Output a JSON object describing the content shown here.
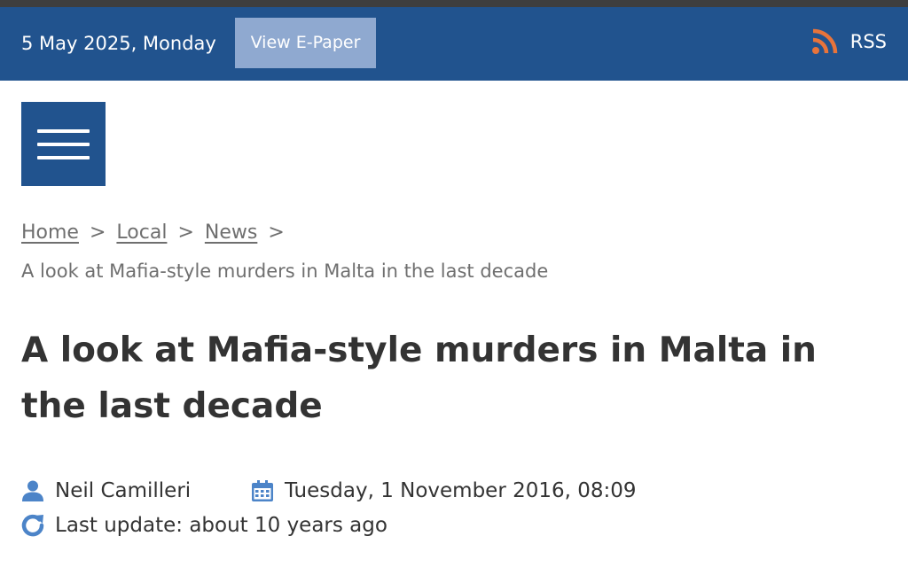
{
  "topbar": {
    "date": "5 May 2025, Monday",
    "epaper_label": "View E-Paper",
    "rss_label": "RSS",
    "rss_icon": "rss-icon",
    "background_color": "#21538e",
    "rss_color": "#e8743b"
  },
  "menu": {
    "icon": "hamburger-menu-icon"
  },
  "breadcrumb": {
    "items": [
      "Home",
      "Local",
      "News"
    ],
    "separator": ">",
    "current": "A look at Mafia-style murders in Malta in the last decade"
  },
  "article": {
    "title": "A look at Mafia-style murders in Malta in the last decade",
    "author": "Neil Camilleri",
    "date": "Tuesday, 1 November 2016, 08:09",
    "last_update": "Last update: about 10 years ago",
    "icon_color": "#4c84c8"
  }
}
